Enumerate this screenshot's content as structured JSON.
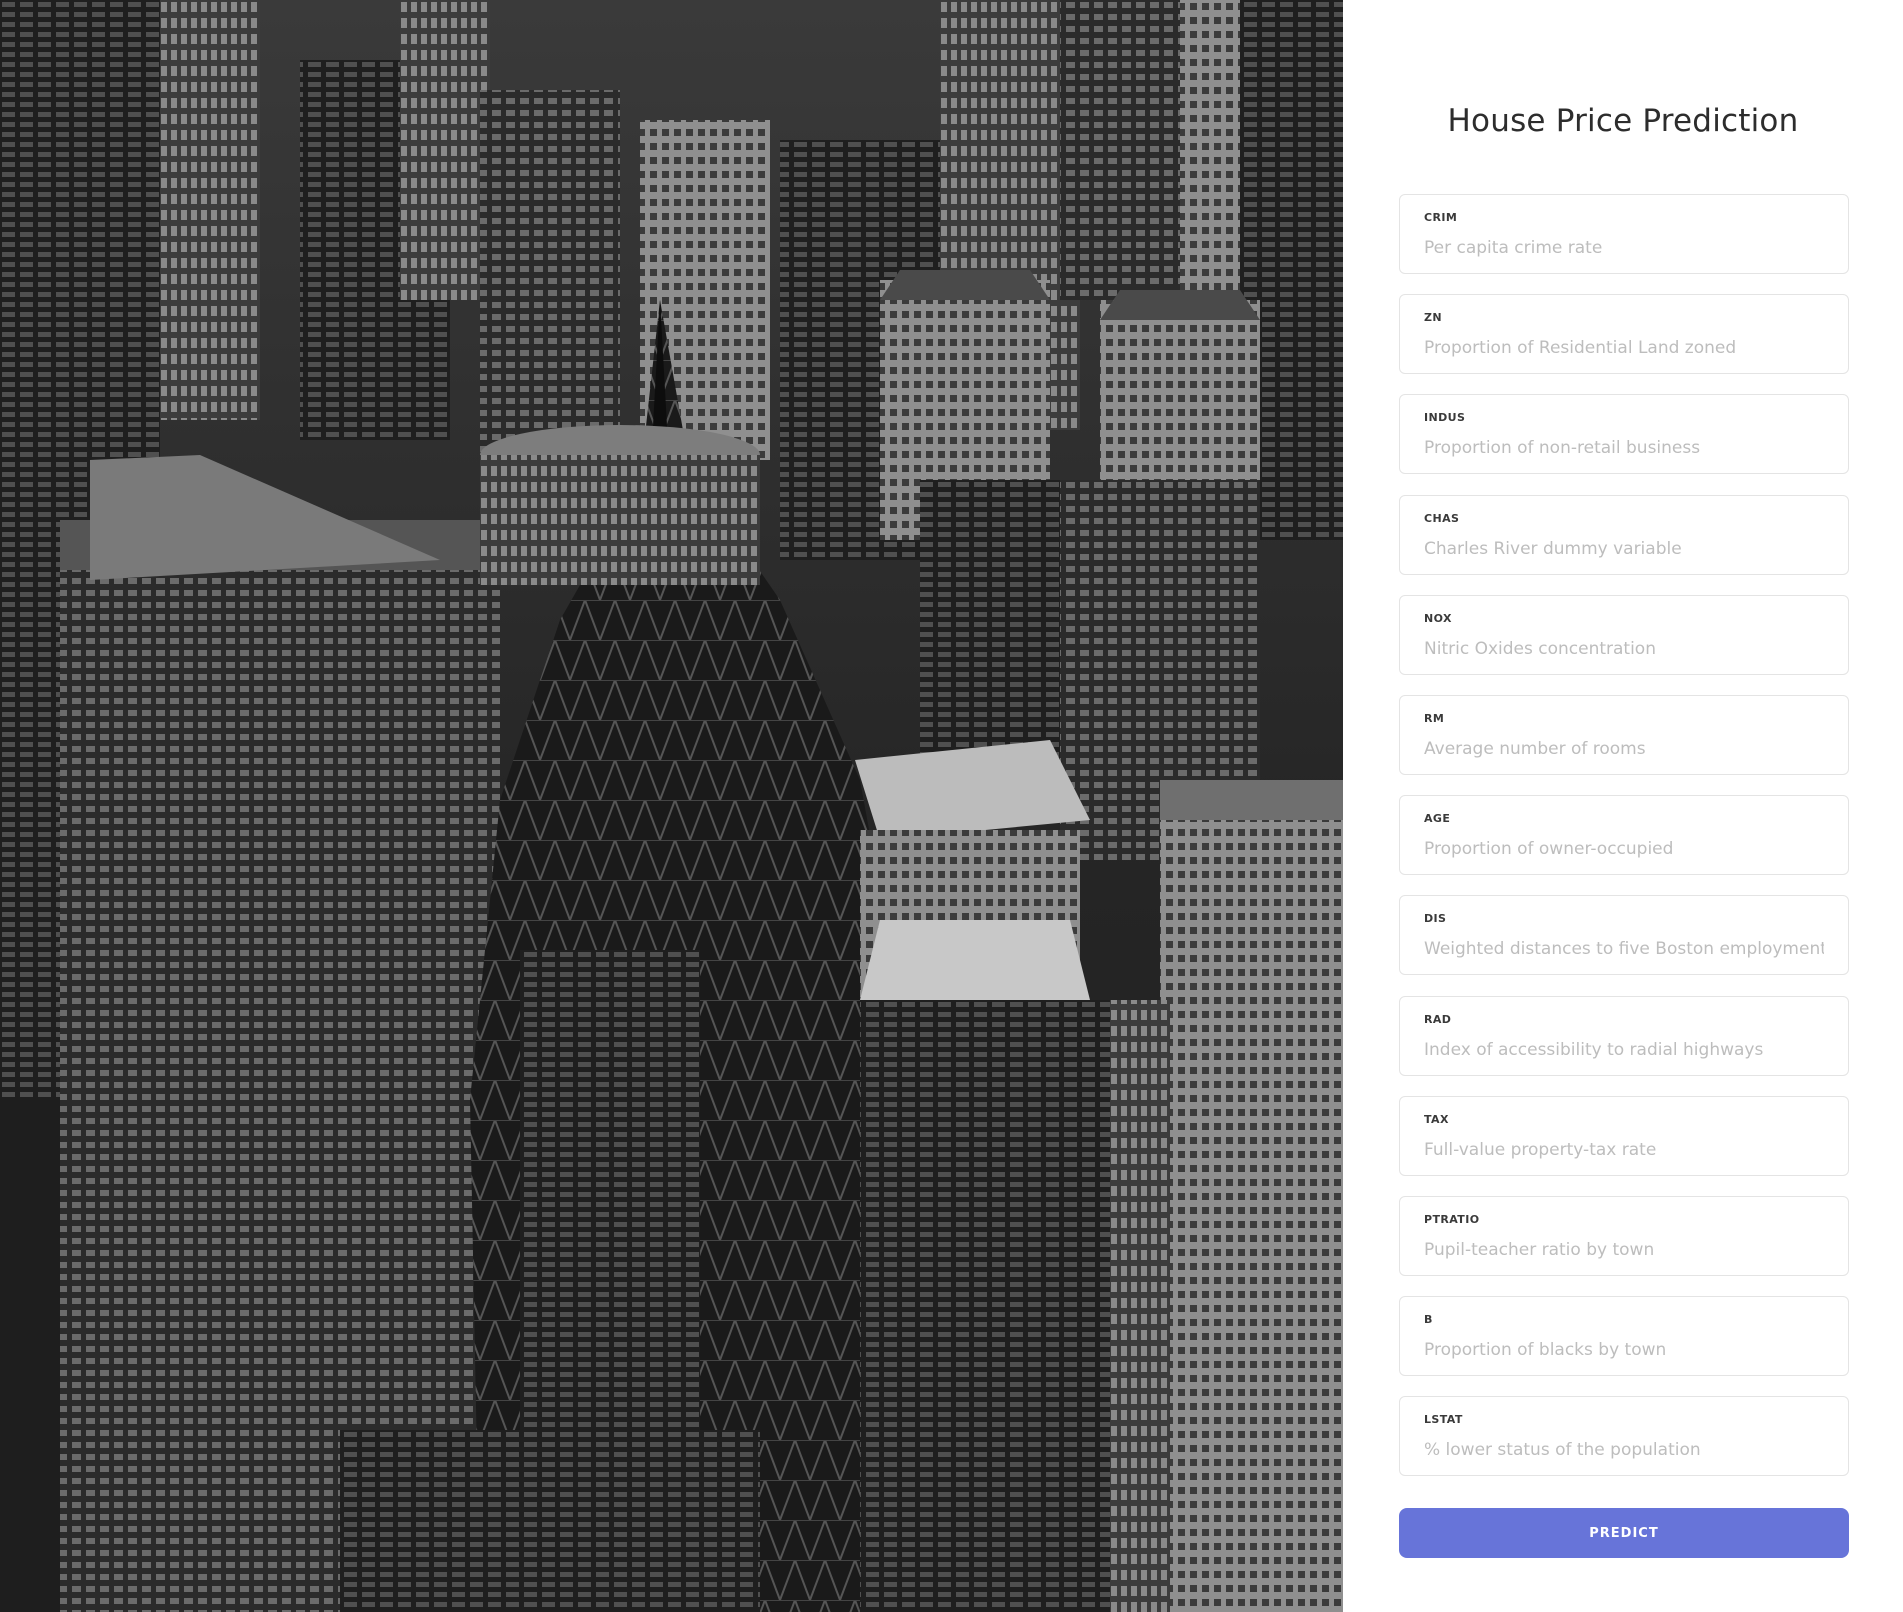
{
  "title": "House Price Prediction",
  "background_image": {
    "description_icon": "city-skyscrapers-photo",
    "tone": "grayscale"
  },
  "form": {
    "fields": [
      {
        "label": "CRIM",
        "placeholder": "Per capita crime rate",
        "value": ""
      },
      {
        "label": "ZN",
        "placeholder": "Proportion of Residential Land zoned",
        "value": ""
      },
      {
        "label": "INDUS",
        "placeholder": "Proportion of non-retail business",
        "value": ""
      },
      {
        "label": "CHAS",
        "placeholder": "Charles River dummy variable",
        "value": ""
      },
      {
        "label": "NOX",
        "placeholder": "Nitric Oxides concentration",
        "value": ""
      },
      {
        "label": "RM",
        "placeholder": "Average number of rooms",
        "value": ""
      },
      {
        "label": "AGE",
        "placeholder": "Proportion of owner-occupied",
        "value": ""
      },
      {
        "label": "DIS",
        "placeholder": "Weighted distances to five Boston employment centres",
        "value": ""
      },
      {
        "label": "RAD",
        "placeholder": "Index of accessibility to radial highways",
        "value": ""
      },
      {
        "label": "TAX",
        "placeholder": "Full-value property-tax rate",
        "value": ""
      },
      {
        "label": "PTRATIO",
        "placeholder": "Pupil-teacher ratio by town",
        "value": ""
      },
      {
        "label": "B",
        "placeholder": "Proportion of blacks by town",
        "value": ""
      },
      {
        "label": "LSTAT",
        "placeholder": "% lower status of the population",
        "value": ""
      }
    ],
    "submit_label": "PREDICT"
  },
  "colors": {
    "accent": "#6774d9",
    "label": "#3a3a3a",
    "placeholder": "#bdbdbd",
    "border": "#e4e4e4"
  }
}
